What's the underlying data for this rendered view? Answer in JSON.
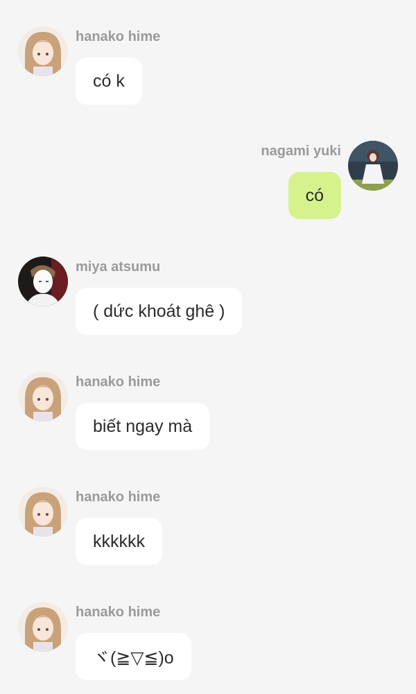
{
  "messages": [
    {
      "sender": "hanako hime",
      "text": "có k",
      "side": "left",
      "avatar_icon": "girl-avatar-icon"
    },
    {
      "sender": "nagami yuki",
      "text": "có",
      "side": "right",
      "avatar_icon": "girl-dress-avatar-icon"
    },
    {
      "sender": "miya atsumu",
      "text": "( dức khoát ghê )",
      "side": "left",
      "avatar_icon": "boy-sketch-avatar-icon"
    },
    {
      "sender": "hanako hime",
      "text": "biết ngay mà",
      "side": "left",
      "avatar_icon": "girl-avatar-icon"
    },
    {
      "sender": "hanako hime",
      "text": "kkkkkk",
      "side": "left",
      "avatar_icon": "girl-avatar-icon"
    },
    {
      "sender": "hanako hime",
      "text": "ヾ(≧▽≦)o",
      "side": "left",
      "avatar_icon": "girl-avatar-icon"
    }
  ],
  "colors": {
    "background": "#f5f5f5",
    "bubble_other": "#ffffff",
    "bubble_self": "#d6f28c",
    "name_text": "#9a9a9a"
  }
}
